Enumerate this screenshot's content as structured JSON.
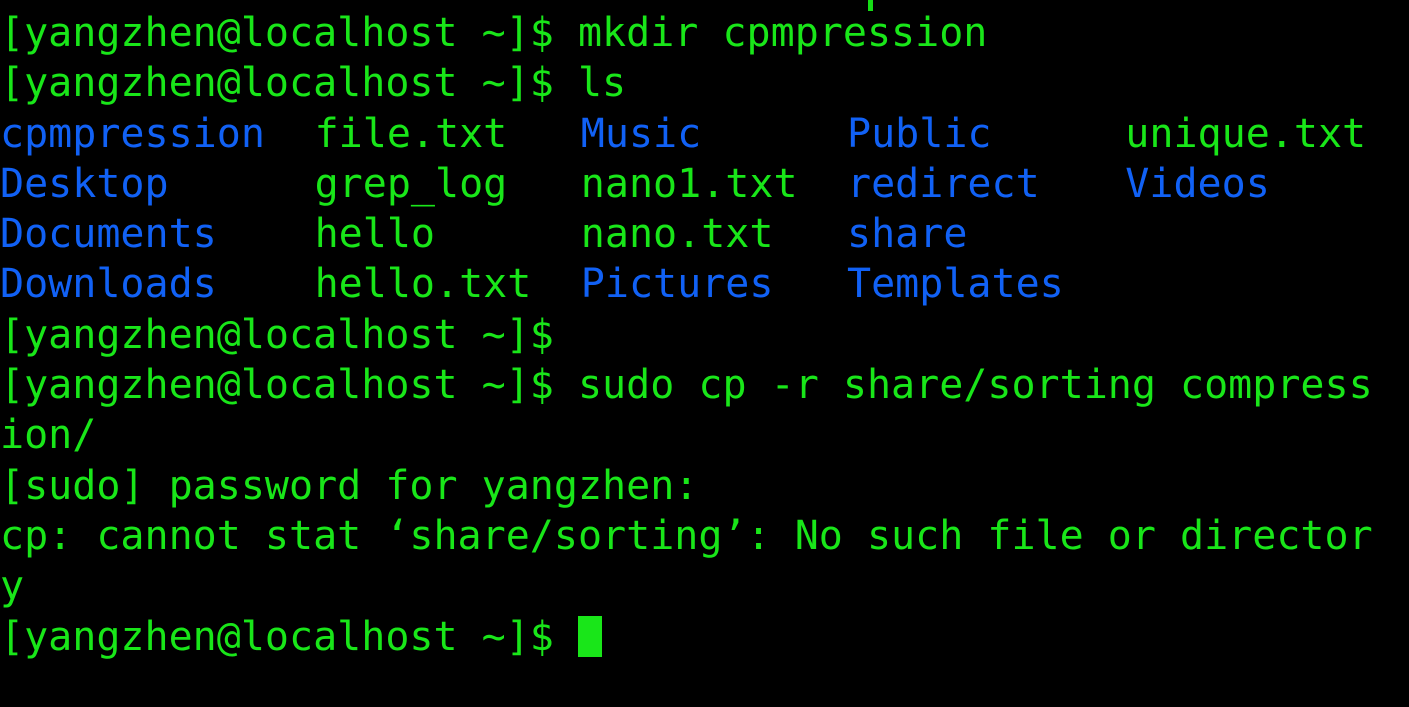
{
  "terminal": {
    "background_color": "#000000",
    "prompt_color": "#19e619",
    "directory_color": "#1161f5",
    "file_color": "#19e619",
    "prompt": "[yangzhen@localhost ~]$ ",
    "cursor": "block",
    "lines": [
      {
        "id": "cmd-mkdir",
        "prompt": "[yangzhen@localhost ~]$ ",
        "command": "mkdir cpmpression"
      },
      {
        "id": "cmd-ls",
        "prompt": "[yangzhen@localhost ~]$ ",
        "command": "ls"
      }
    ],
    "ls_output": {
      "columns": 5,
      "rows": [
        [
          {
            "name": "cpmpression",
            "type": "dir"
          },
          {
            "name": "file.txt",
            "type": "file"
          },
          {
            "name": "Music",
            "type": "dir"
          },
          {
            "name": "Public",
            "type": "dir"
          },
          {
            "name": "unique.txt",
            "type": "file"
          }
        ],
        [
          {
            "name": "Desktop",
            "type": "dir"
          },
          {
            "name": "grep_log",
            "type": "file"
          },
          {
            "name": "nano1.txt",
            "type": "file"
          },
          {
            "name": "redirect",
            "type": "dir"
          },
          {
            "name": "Videos",
            "type": "dir"
          }
        ],
        [
          {
            "name": "Documents",
            "type": "dir"
          },
          {
            "name": "hello",
            "type": "file"
          },
          {
            "name": "nano.txt",
            "type": "file"
          },
          {
            "name": "share",
            "type": "dir"
          },
          {
            "name": "",
            "type": "none"
          }
        ],
        [
          {
            "name": "Downloads",
            "type": "dir"
          },
          {
            "name": "hello.txt",
            "type": "file"
          },
          {
            "name": "Pictures",
            "type": "dir"
          },
          {
            "name": "Templates",
            "type": "dir"
          },
          {
            "name": "",
            "type": "none"
          }
        ]
      ]
    },
    "empty_prompt_line": "[yangzhen@localhost ~]$",
    "sudo_line": {
      "prompt": "[yangzhen@localhost ~]$ ",
      "command_part1": "sudo cp -r share/sorting compress",
      "command_part2": "ion/"
    },
    "password_prompt": "[sudo] password for yangzhen:",
    "error": {
      "part1": "cp: cannot stat ‘share/sorting’: No such file or director",
      "part2": "y"
    },
    "final_prompt": "[yangzhen@localhost ~]$ "
  }
}
